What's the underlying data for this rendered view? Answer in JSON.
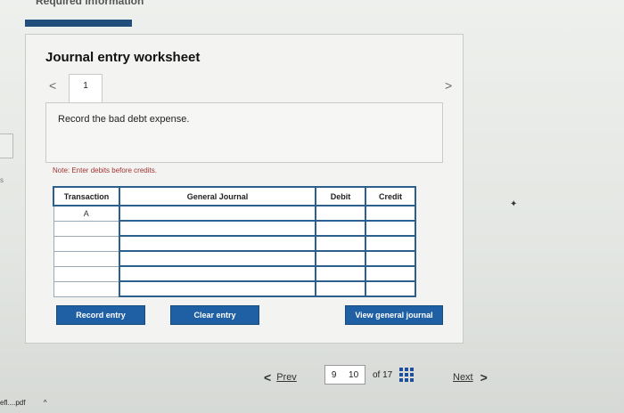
{
  "header": {
    "required_label": "Required information"
  },
  "worksheet": {
    "title": "Journal entry worksheet",
    "tab_number": "1",
    "instruction": "Record the bad debt expense.",
    "note": "Note: Enter debits before credits."
  },
  "table": {
    "columns": [
      "Transaction",
      "General Journal",
      "Debit",
      "Credit"
    ],
    "rows": [
      [
        "A",
        "",
        "",
        ""
      ],
      [
        "",
        "",
        "",
        ""
      ],
      [
        "",
        "",
        "",
        ""
      ],
      [
        "",
        "",
        "",
        ""
      ],
      [
        "",
        "",
        "",
        ""
      ],
      [
        "",
        "",
        "",
        ""
      ]
    ]
  },
  "buttons": {
    "record": "Record entry",
    "clear": "Clear entry",
    "view": "View general journal"
  },
  "pagination": {
    "prev": "Prev",
    "page_before": "9",
    "current_page": "10",
    "total": "of 17",
    "next": "Next"
  },
  "sidebar_edge": {
    "s_fragment": "s",
    "download_label": "efl....pdf",
    "caret": "^"
  }
}
